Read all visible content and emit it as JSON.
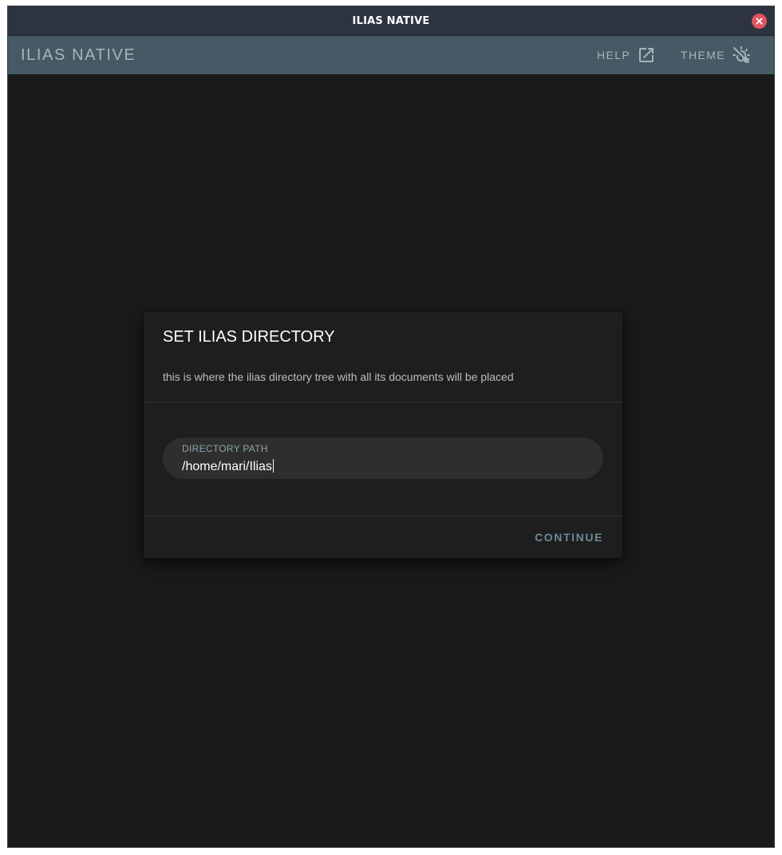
{
  "window": {
    "title": "ILIAS NATIVE"
  },
  "app_bar": {
    "title": "ILIAS NATIVE",
    "help_label": "HELP",
    "help_icon": "open-in-new-icon",
    "theme_label": "THEME",
    "theme_icon": "theme-auto-icon"
  },
  "dialog": {
    "title": "SET ILIAS DIRECTORY",
    "subtitle": "this is where the ilias directory tree with all its documents will be placed",
    "field_label": "DIRECTORY PATH",
    "field_value": "/home/mari/Ilias",
    "continue_label": "CONTINUE"
  },
  "colors": {
    "titlebar": "#2d3340",
    "app_bar": "#455a64",
    "background": "#1a1a1a",
    "dialog": "#1e1e1e",
    "close_button": "#e2545f",
    "accent_text": "#6d8896"
  }
}
